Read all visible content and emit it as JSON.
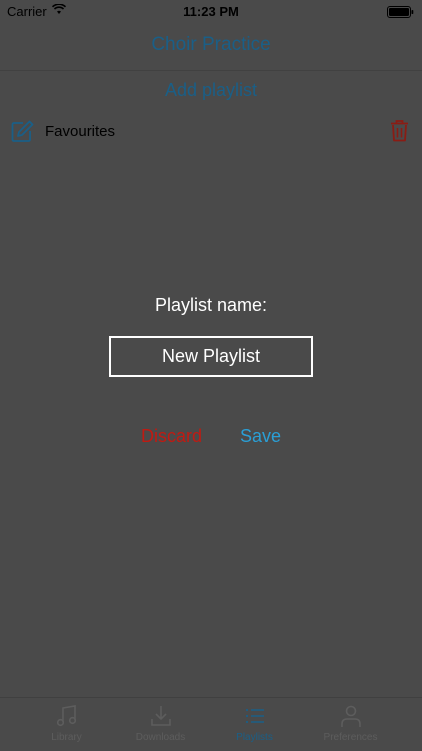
{
  "status_bar": {
    "carrier": "Carrier",
    "time": "11:23 PM"
  },
  "header": {
    "title": "Choir Practice"
  },
  "playlists": {
    "add_label": "Add playlist",
    "items": [
      {
        "name": "Favourites"
      }
    ]
  },
  "dialog": {
    "label": "Playlist name:",
    "input_value": "New Playlist",
    "discard_label": "Discard",
    "save_label": "Save"
  },
  "tab_bar": {
    "tabs": [
      {
        "label": "Library",
        "icon": "music-note-icon"
      },
      {
        "label": "Downloads",
        "icon": "download-icon"
      },
      {
        "label": "Playlists",
        "icon": "list-icon",
        "active": true
      },
      {
        "label": "Preferences",
        "icon": "person-icon"
      }
    ]
  },
  "colors": {
    "accent": "#1a5f87",
    "overlay_background": "#4a4a4a",
    "discard": "#c01a12",
    "save": "#2a9fd6"
  }
}
